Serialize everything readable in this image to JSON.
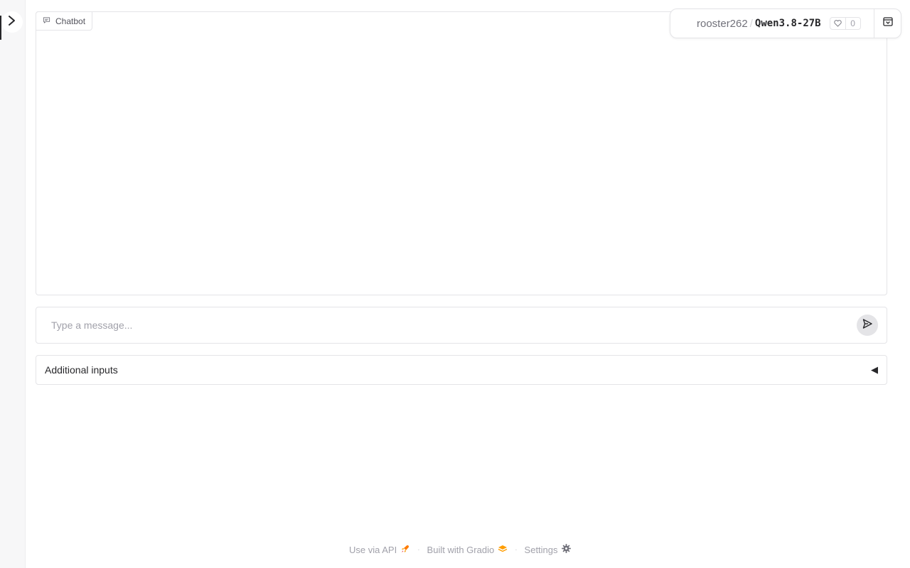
{
  "sidebar": {
    "toggle_icon": "chevron-right-icon"
  },
  "chatbot": {
    "label": "Chatbot",
    "icon": "chat-bubble-icon"
  },
  "composer": {
    "placeholder": "Type a message...",
    "send_icon": "send-icon"
  },
  "accordion": {
    "label": "Additional inputs",
    "arrow": "◀"
  },
  "space": {
    "owner": "rooster262",
    "name": "Qwen3.8-27B",
    "likes": "0",
    "like_icon": "heart-icon",
    "collapse_icon": "collapse-icon"
  },
  "footer": {
    "api_label": "Use via API",
    "gradio_label": "Built with Gradio",
    "settings_label": "Settings",
    "separator": "·"
  },
  "colors": {
    "accent": "#ff7c00",
    "border": "#e4e4e7",
    "muted_text": "#a1a1aa"
  }
}
